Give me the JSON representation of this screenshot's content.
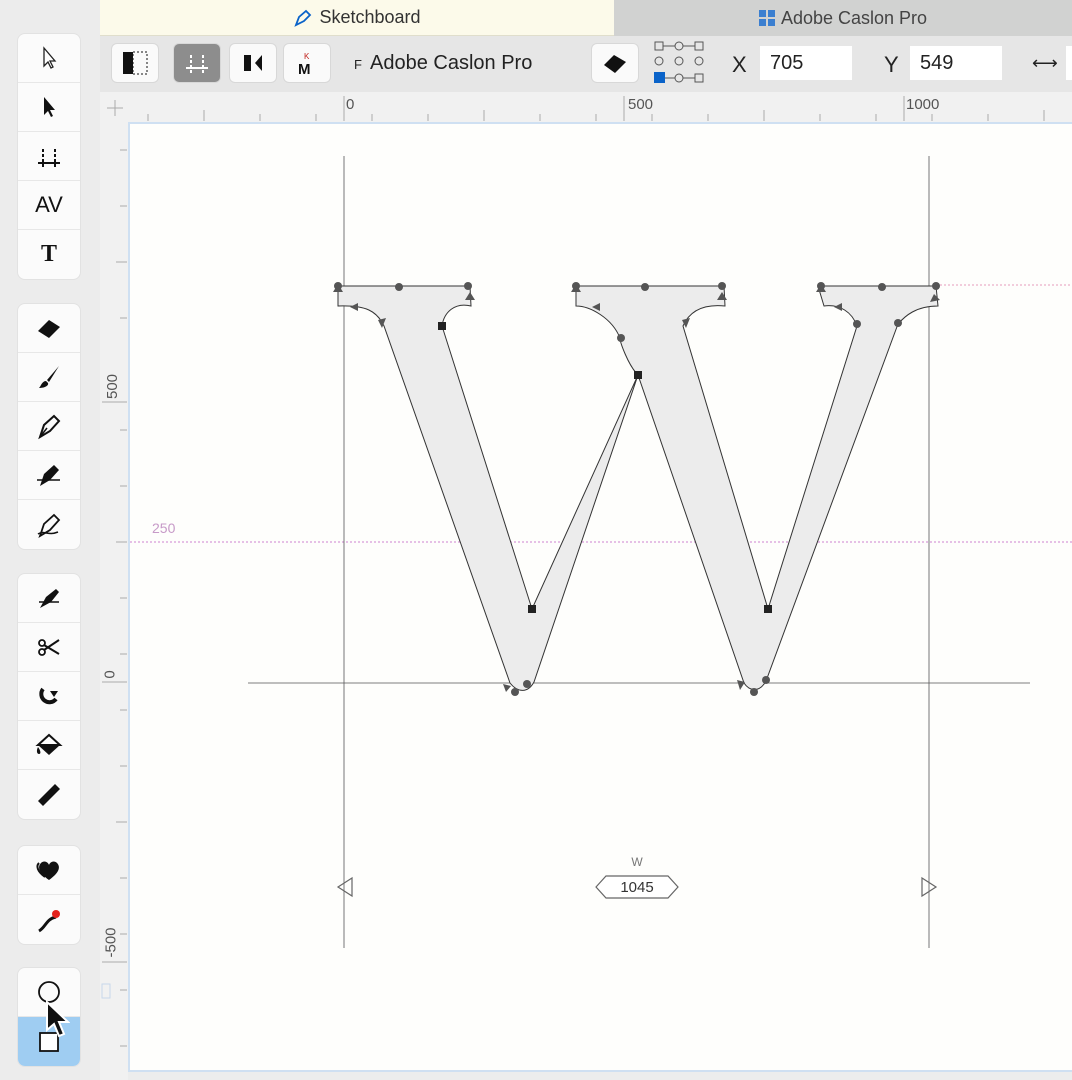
{
  "tabs": [
    {
      "label": "Sketchboard",
      "icon": "pen-icon",
      "active": true
    },
    {
      "label": "Adobe Caslon Pro",
      "icon": "grid-icon",
      "active": false
    }
  ],
  "controlbar": {
    "font_prefix": "F",
    "font_name": "Adobe Caslon Pro",
    "x_label": "X",
    "x_value": "705",
    "y_label": "Y",
    "y_value": "549",
    "width_icon": "⟷"
  },
  "tools": {
    "group1": [
      "select-arrow-outline-icon",
      "select-arrow-icon",
      "metrics-icon",
      "kerning-icon",
      "text-tool-icon"
    ],
    "group2": [
      "eraser-icon",
      "brush-icon",
      "pen-icon",
      "calligraphy-pen-icon",
      "pencil-pen-icon"
    ],
    "group3": [
      "knife-icon",
      "scissors-icon",
      "magnet-icon",
      "paint-bucket-icon",
      "ruler-icon"
    ],
    "group4": [
      "hearts-icon",
      "curve-point-icon"
    ],
    "group5": [
      "ellipse-icon",
      "rectangle-icon"
    ],
    "kerning_glyph": "AV",
    "text_glyph": "T"
  },
  "rulers": {
    "top_labels": [
      "0",
      "500",
      "1000"
    ],
    "left_labels": [
      "500",
      "0",
      "-500"
    ]
  },
  "canvas": {
    "guide_label": "250",
    "width_caption": "W",
    "width_value": "1045",
    "glyph": "W",
    "accent": "#0a63c9",
    "guide_color": "#d79ad8"
  }
}
